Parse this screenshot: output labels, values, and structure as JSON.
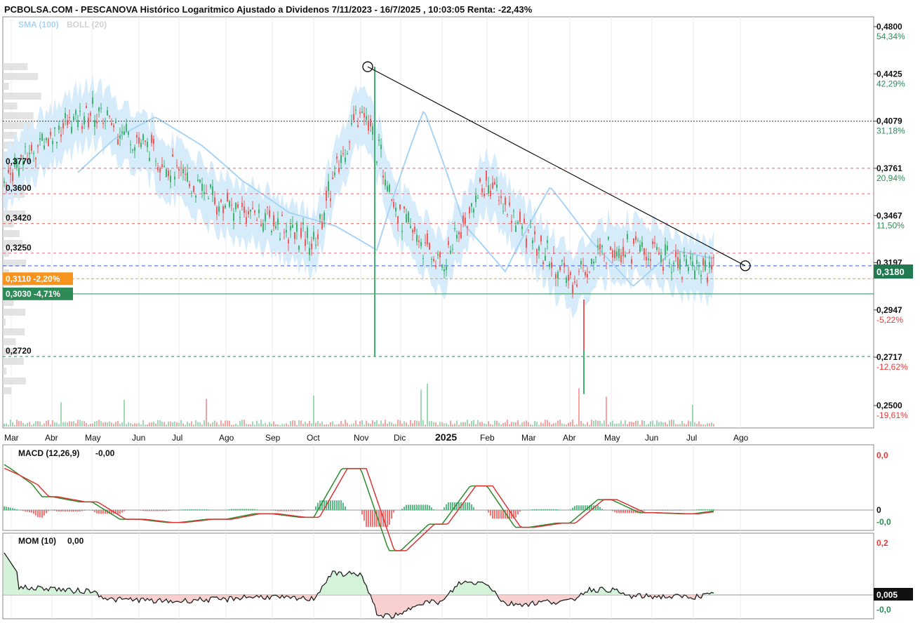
{
  "header": {
    "title": "PCBOLSA.COM - PESCANOVA Histórico Logaritmico Ajustado a Dividenos 7/11/2023 - 16/7/2025 , 10:03:05 Renta: -22,43%",
    "legend_sma": "SMA (100)",
    "legend_boll": "BOLL (20)"
  },
  "colors": {
    "up": "#3cb371",
    "down": "#f25a5a",
    "band": "#d6ecfb",
    "sma": "#a9d4f5",
    "orange": "#f7941d",
    "green_label": "#2e8b57",
    "blue_line": "#3b5bdb"
  },
  "chart_data": [
    {
      "type": "line",
      "title": "",
      "scale": "log",
      "x_axis_labels": [
        "Mar",
        "Abr",
        "May",
        "Jun",
        "Jul",
        "Ago",
        "Sep",
        "Oct",
        "Nov",
        "Dic",
        "2025",
        "Feb",
        "Mar",
        "Abr",
        "May",
        "Jun",
        "Jul",
        "Ago"
      ],
      "y_ticks": [
        {
          "price": "0,4800",
          "pct": "54,34%",
          "sign": "pos"
        },
        {
          "price": "0,4425",
          "pct": "42,29%",
          "sign": "pos"
        },
        {
          "price": "0,4079",
          "pct": "31,18%",
          "sign": "pos"
        },
        {
          "price": "0,3761",
          "pct": "20,94%",
          "sign": "pos"
        },
        {
          "price": "0,3467",
          "pct": "11,50%",
          "sign": "pos"
        },
        {
          "price": "0,3197",
          "pct": "",
          "sign": "pos"
        },
        {
          "price": "0,2947",
          "pct": "-5,22%",
          "sign": "neg"
        },
        {
          "price": "0,2717",
          "pct": "-12,62%",
          "sign": "neg"
        },
        {
          "price": "0,2500",
          "pct": "-19,61%",
          "sign": "neg"
        }
      ],
      "current_price": "0,3180",
      "support_resistance_labels": [
        {
          "price": "0,3770",
          "kind": "plain"
        },
        {
          "price": "0,3600",
          "kind": "plain"
        },
        {
          "price": "0,3420",
          "kind": "plain"
        },
        {
          "price": "0,3250",
          "kind": "plain"
        },
        {
          "price": "0,3110",
          "pct": "-2,20%",
          "kind": "orange"
        },
        {
          "price": "0,3030",
          "pct": "-4,71%",
          "kind": "green"
        },
        {
          "price": "0,2720",
          "kind": "plain"
        }
      ],
      "price_series": [
        [
          "2023-11",
          0.39
        ],
        [
          "2023-12",
          0.37
        ],
        [
          "2024-01",
          0.36
        ],
        [
          "2024-02",
          0.345
        ],
        [
          "2024-03",
          0.375
        ],
        [
          "2024-04",
          0.4
        ],
        [
          "2024-05",
          0.415
        ],
        [
          "2024-06",
          0.395
        ],
        [
          "2024-07",
          0.372
        ],
        [
          "2024-08",
          0.352
        ],
        [
          "2024-09",
          0.344
        ],
        [
          "2024-10",
          0.33
        ],
        [
          "2024-11",
          0.42
        ],
        [
          "2024-12",
          0.345
        ],
        [
          "2025-01",
          0.318
        ],
        [
          "2025-02",
          0.368
        ],
        [
          "2025-03",
          0.335
        ],
        [
          "2025-04",
          0.31
        ],
        [
          "2025-05",
          0.33
        ],
        [
          "2025-06",
          0.325
        ],
        [
          "2025-07",
          0.318
        ]
      ],
      "trendline": {
        "from": [
          "2024-11",
          0.448
        ],
        "to": [
          "2025-08",
          0.318
        ]
      }
    },
    {
      "type": "line",
      "title": "MACD (12,26,9)",
      "value": "-0,00",
      "y_ticks": [
        "0,0",
        "0",
        "-0,0"
      ]
    },
    {
      "type": "line",
      "title": "MOM (10)",
      "value": "0,00",
      "current": "0,005",
      "y_ticks": [
        "0,2",
        "-0,0"
      ]
    }
  ]
}
